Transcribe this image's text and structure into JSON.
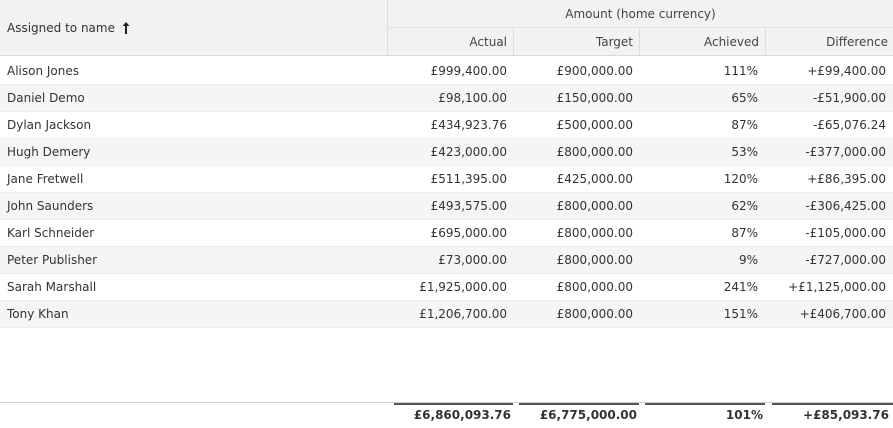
{
  "header": {
    "name_column": "Assigned to name",
    "group_label": "Amount (home currency)",
    "columns": [
      "Actual",
      "Target",
      "Achieved",
      "Difference"
    ]
  },
  "rows": [
    {
      "name": "Alison Jones",
      "actual": "£999,400.00",
      "target": "£900,000.00",
      "achieved": "111%",
      "difference": "+£99,400.00"
    },
    {
      "name": "Daniel Demo",
      "actual": "£98,100.00",
      "target": "£150,000.00",
      "achieved": "65%",
      "difference": "-£51,900.00"
    },
    {
      "name": "Dylan Jackson",
      "actual": "£434,923.76",
      "target": "£500,000.00",
      "achieved": "87%",
      "difference": "-£65,076.24"
    },
    {
      "name": "Hugh Demery",
      "actual": "£423,000.00",
      "target": "£800,000.00",
      "achieved": "53%",
      "difference": "-£377,000.00"
    },
    {
      "name": "Jane Fretwell",
      "actual": "£511,395.00",
      "target": "£425,000.00",
      "achieved": "120%",
      "difference": "+£86,395.00"
    },
    {
      "name": "John Saunders",
      "actual": "£493,575.00",
      "target": "£800,000.00",
      "achieved": "62%",
      "difference": "-£306,425.00"
    },
    {
      "name": "Karl Schneider",
      "actual": "£695,000.00",
      "target": "£800,000.00",
      "achieved": "87%",
      "difference": "-£105,000.00"
    },
    {
      "name": "Peter Publisher",
      "actual": "£73,000.00",
      "target": "£800,000.00",
      "achieved": "9%",
      "difference": "-£727,000.00"
    },
    {
      "name": "Sarah Marshall",
      "actual": "£1,925,000.00",
      "target": "£800,000.00",
      "achieved": "241%",
      "difference": "+£1,125,000.00"
    },
    {
      "name": "Tony Khan",
      "actual": "£1,206,700.00",
      "target": "£800,000.00",
      "achieved": "151%",
      "difference": "+£406,700.00"
    }
  ],
  "totals": {
    "actual": "£6,860,093.76",
    "target": "£6,775,000.00",
    "achieved": "101%",
    "difference": "+£85,093.76"
  },
  "icons": {
    "sort": "sort-ascending-arrow-icon"
  },
  "colors": {
    "header_bg": "#f2f2f2",
    "row_alt_bg": "#f5f5f5",
    "text": "#333333"
  }
}
